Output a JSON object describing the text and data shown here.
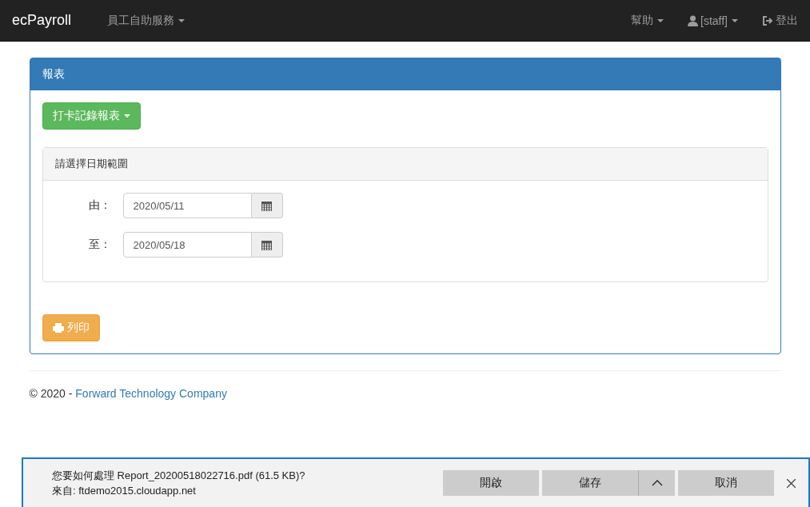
{
  "navbar": {
    "brand": "ecPayroll",
    "left_menu": [
      {
        "label": "員工自助服務"
      }
    ],
    "right_menu": [
      {
        "label": "幫助",
        "kind": "dropdown"
      },
      {
        "label": "[staff]",
        "kind": "user"
      },
      {
        "label": "登出",
        "kind": "logout"
      }
    ]
  },
  "panel": {
    "title": "報表",
    "report_button": "打卡記錄報表",
    "range_panel": {
      "title": "請選擇日期範圍",
      "fields": [
        {
          "label": "由：",
          "value": "2020/05/11"
        },
        {
          "label": "至：",
          "value": "2020/05/18"
        }
      ]
    },
    "print_button": "列印"
  },
  "footer": {
    "text": "© 2020 - ",
    "link": "Forward Technology Company"
  },
  "download_bar": {
    "question": "您要如何處理 Report_20200518022716.pdf (61.5 KB)?",
    "source": "來自: ftdemo2015.cloudapp.net",
    "buttons": [
      "開啟",
      "儲存",
      "取消"
    ]
  }
}
